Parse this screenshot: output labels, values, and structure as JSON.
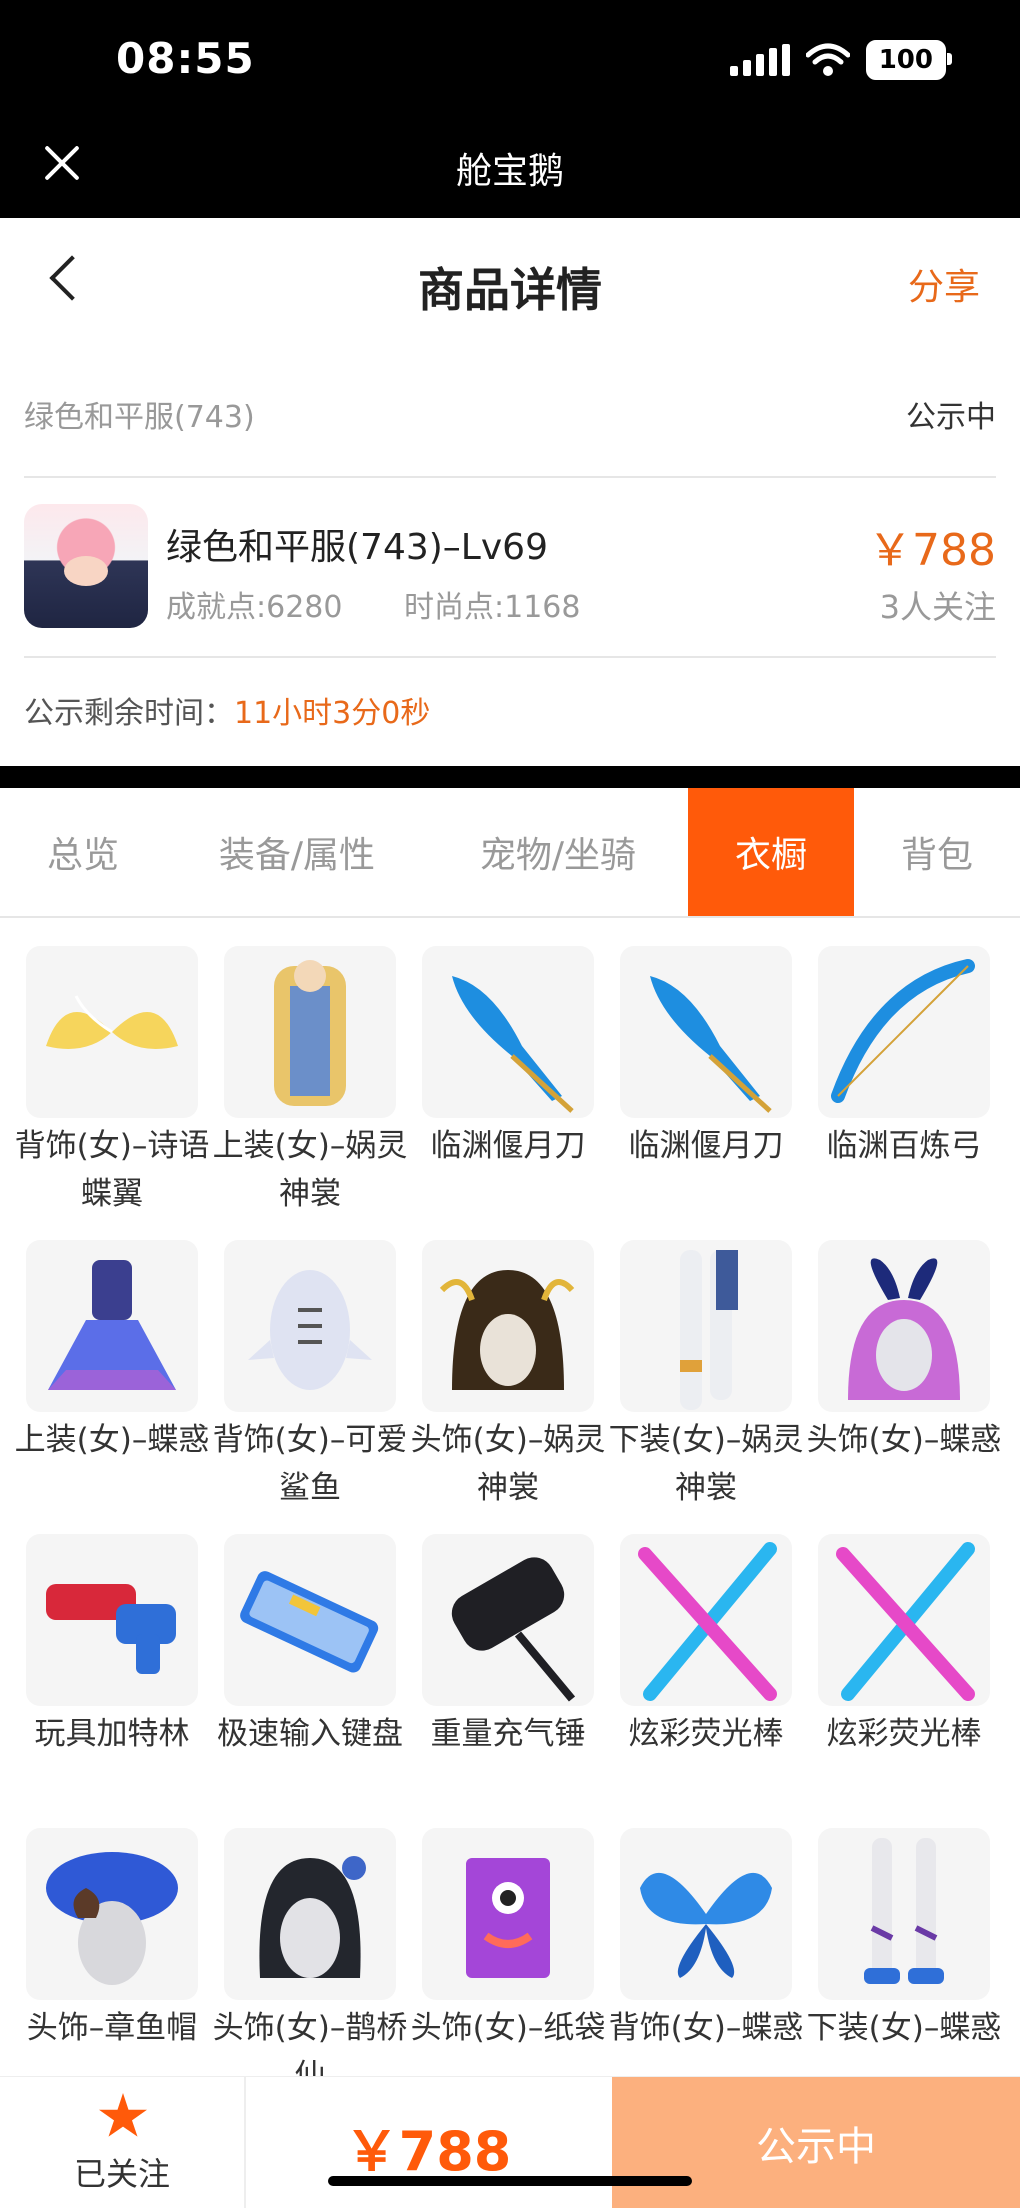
{
  "status_bar": {
    "time": "08:55",
    "battery": "100"
  },
  "app_bar": {
    "title": "舱宝鹅"
  },
  "header": {
    "title": "商品详情",
    "share": "分享"
  },
  "info": {
    "listing_name": "绿色和平服(743)",
    "status": "公示中"
  },
  "product": {
    "name": "绿色和平服(743)–Lv69",
    "achievement": "成就点:6280",
    "fashion": "时尚点:1168",
    "price": "￥788",
    "followers": "3人关注"
  },
  "timer": {
    "label": "公示剩余时间：",
    "value": "11小时3分0秒"
  },
  "tabs": [
    {
      "label": "总览",
      "active": false
    },
    {
      "label": "装备/属性",
      "active": false
    },
    {
      "label": "宠物/坐骑",
      "active": false
    },
    {
      "label": "衣橱",
      "active": true
    },
    {
      "label": "背包",
      "active": false
    }
  ],
  "wardrobe": [
    {
      "label": "背饰(女)–诗语蝶翼",
      "icon": "wings-icon"
    },
    {
      "label": "上装(女)–娲灵神裳",
      "icon": "robe-icon"
    },
    {
      "label": "临渊偃月刀",
      "icon": "blade-icon"
    },
    {
      "label": "临渊偃月刀",
      "icon": "blade-icon"
    },
    {
      "label": "临渊百炼弓",
      "icon": "bow-icon"
    },
    {
      "label": "上装(女)–蝶惑",
      "icon": "dress-icon"
    },
    {
      "label": "背饰(女)–可爱鲨鱼",
      "icon": "shark-icon"
    },
    {
      "label": "头饰(女)–娲灵神裳",
      "icon": "headwear-icon"
    },
    {
      "label": "下装(女)–娲灵神裳",
      "icon": "legs-icon"
    },
    {
      "label": "头饰(女)–蝶惑",
      "icon": "bunny-ears-icon"
    },
    {
      "label": "玩具加特林",
      "icon": "toy-gun-icon"
    },
    {
      "label": "极速输入键盘",
      "icon": "keyboard-icon"
    },
    {
      "label": "重量充气锤",
      "icon": "hammer-icon"
    },
    {
      "label": "炫彩荧光棒",
      "icon": "glowstick-icon"
    },
    {
      "label": "炫彩荧光棒",
      "icon": "glowstick-icon"
    },
    {
      "label": "头饰–章鱼帽",
      "icon": "octopus-hat-icon"
    },
    {
      "label": "头饰(女)–鹊桥仙",
      "icon": "hairpin-icon"
    },
    {
      "label": "头饰(女)–纸袋",
      "icon": "paper-bag-icon"
    },
    {
      "label": "背饰(女)–蝶惑",
      "icon": "butterfly-icon"
    },
    {
      "label": "下装(女)–蝶惑",
      "icon": "heels-icon"
    }
  ],
  "bottom_bar": {
    "follow_label": "已关注",
    "price": "￥788",
    "status": "公示中"
  },
  "colors": {
    "accent": "#ff5a0a",
    "price": "#e8691a",
    "status_button": "#fcb07e"
  }
}
